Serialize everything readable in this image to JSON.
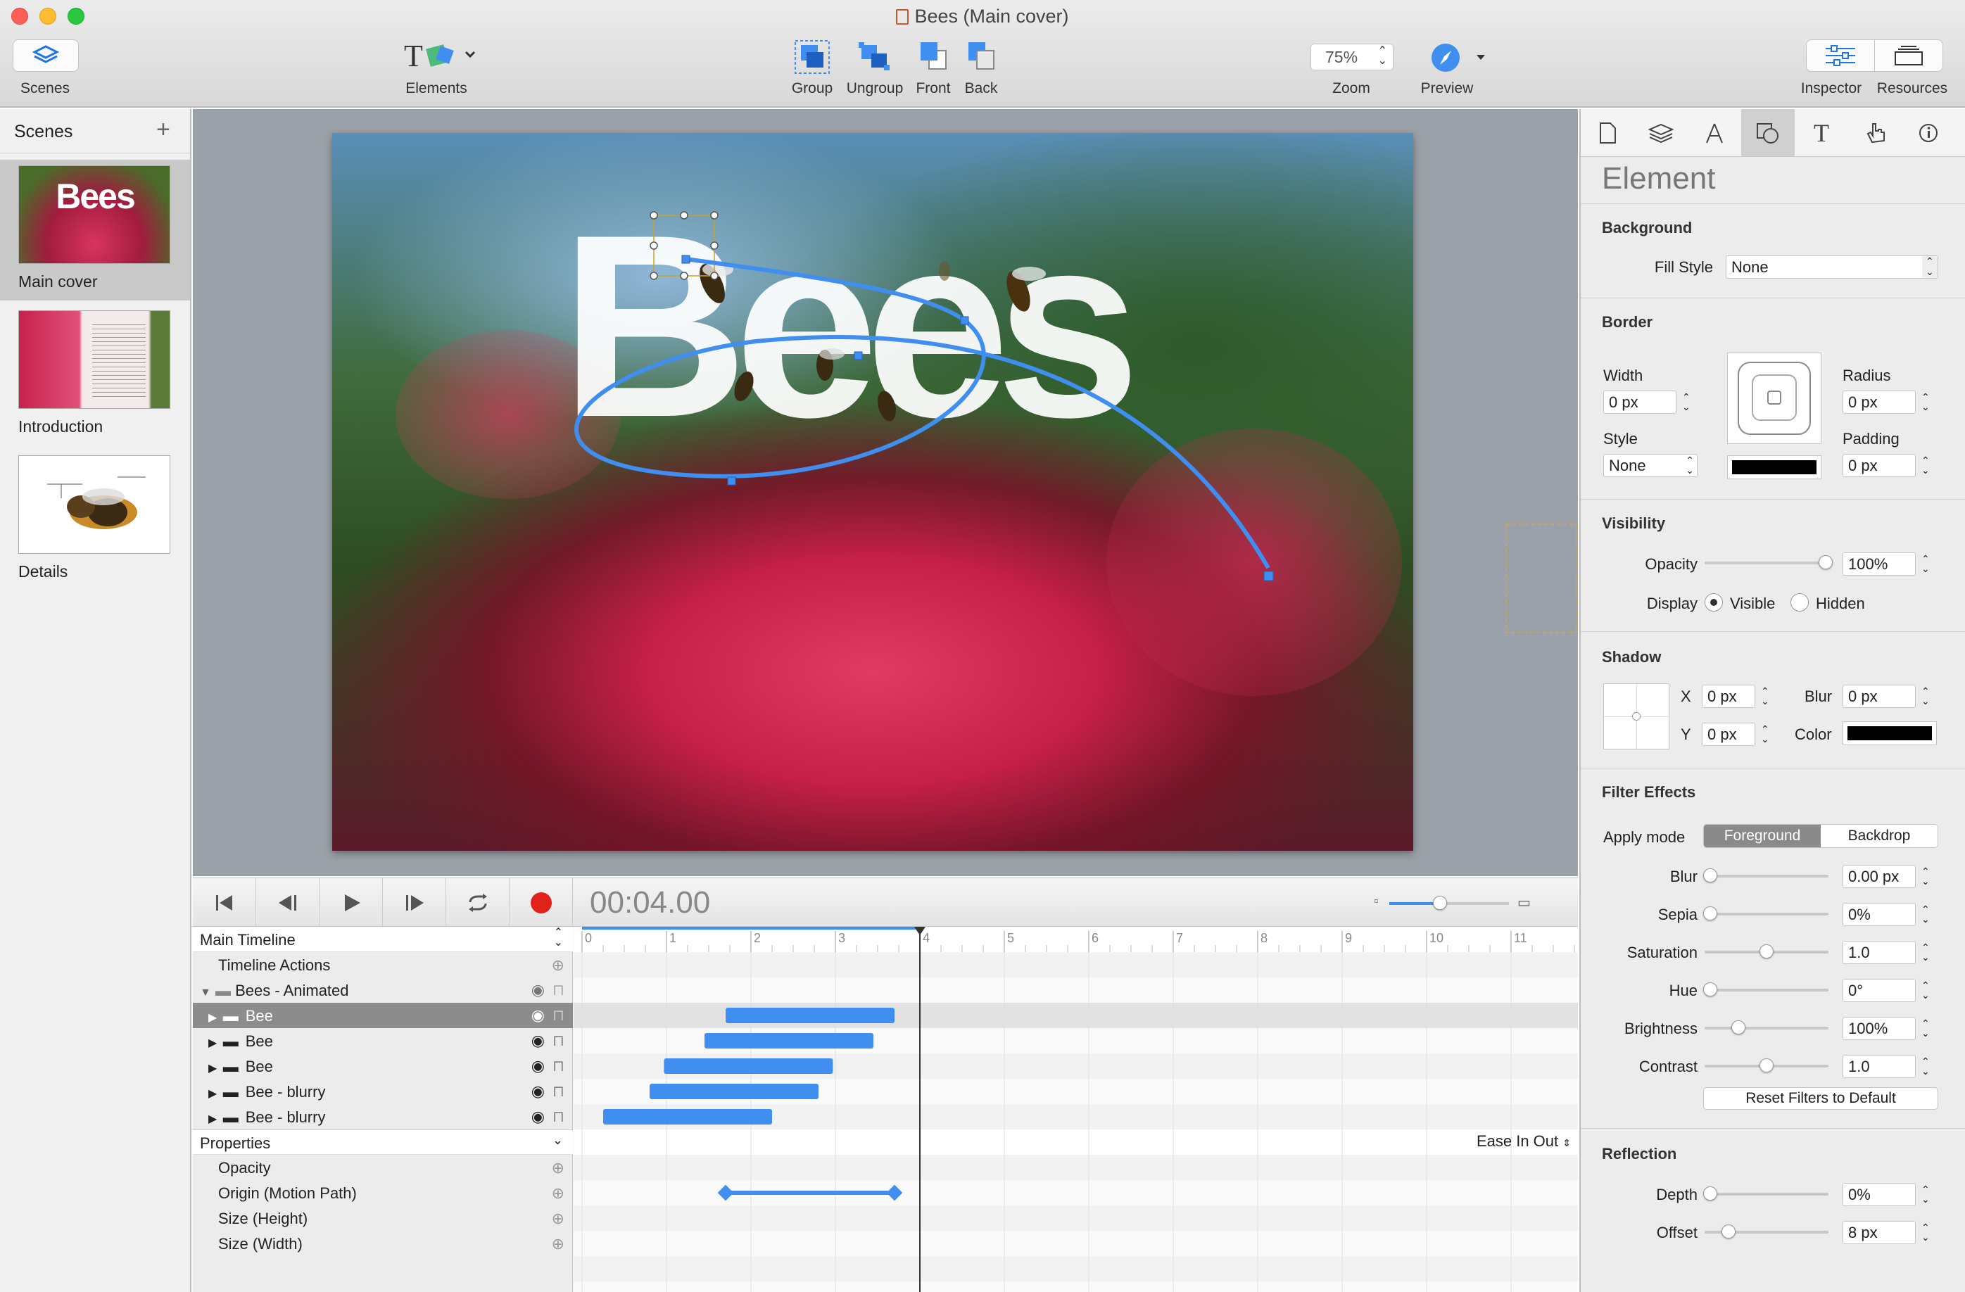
{
  "window": {
    "title": "Bees (Main cover)"
  },
  "toolbar": {
    "scenes": "Scenes",
    "elements": "Elements",
    "group": "Group",
    "ungroup": "Ungroup",
    "front": "Front",
    "back": "Back",
    "zoom_value": "75%",
    "zoom": "Zoom",
    "preview": "Preview",
    "inspector": "Inspector",
    "resources": "Resources"
  },
  "scenes_panel": {
    "header": "Scenes",
    "items": [
      {
        "label": "Main cover",
        "thumb_title": "Bees"
      },
      {
        "label": "Introduction"
      },
      {
        "label": "Details"
      }
    ]
  },
  "canvas": {
    "headline": "Bees"
  },
  "inspector": {
    "title": "Element",
    "background": {
      "title": "Background",
      "fill_style_label": "Fill Style",
      "fill_style_value": "None"
    },
    "border": {
      "title": "Border",
      "width_label": "Width",
      "width_value": "0 px",
      "radius_label": "Radius",
      "radius_value": "0 px",
      "style_label": "Style",
      "style_value": "None",
      "padding_label": "Padding",
      "padding_value": "0 px"
    },
    "visibility": {
      "title": "Visibility",
      "opacity_label": "Opacity",
      "opacity_value": "100%",
      "display_label": "Display",
      "visible": "Visible",
      "hidden": "Hidden"
    },
    "shadow": {
      "title": "Shadow",
      "x_label": "X",
      "x_value": "0 px",
      "y_label": "Y",
      "y_value": "0 px",
      "blur_label": "Blur",
      "blur_value": "0 px",
      "color_label": "Color"
    },
    "filters": {
      "title": "Filter Effects",
      "apply_mode_label": "Apply mode",
      "foreground": "Foreground",
      "backdrop": "Backdrop",
      "rows": [
        {
          "label": "Blur",
          "value": "0.00 px",
          "level": 0
        },
        {
          "label": "Sepia",
          "value": "0%",
          "level": 0
        },
        {
          "label": "Saturation",
          "value": "1.0",
          "level": 0.5
        },
        {
          "label": "Hue",
          "value": "0°",
          "level": 0
        },
        {
          "label": "Brightness",
          "value": "100%",
          "level": 0.25
        },
        {
          "label": "Contrast",
          "value": "1.0",
          "level": 0.5
        }
      ],
      "reset": "Reset Filters to Default"
    },
    "reflection": {
      "title": "Reflection",
      "depth_label": "Depth",
      "depth_value": "0%",
      "offset_label": "Offset",
      "offset_value": "8 px"
    }
  },
  "timeline": {
    "time": "00:04.00",
    "main": "Main Timeline",
    "actions": "Timeline Actions",
    "group": "Bees - Animated",
    "layers": [
      {
        "name": "Bee",
        "start": 1.7,
        "end": 3.7
      },
      {
        "name": "Bee",
        "start": 1.45,
        "end": 3.45
      },
      {
        "name": "Bee",
        "start": 0.97,
        "end": 2.97
      },
      {
        "name": "Bee - blurry",
        "start": 0.8,
        "end": 2.8
      },
      {
        "name": "Bee - blurry",
        "start": 0.25,
        "end": 2.25
      }
    ],
    "properties": "Properties",
    "easing": "Ease In Out",
    "props": [
      {
        "name": "Opacity"
      },
      {
        "name": "Origin (Motion Path)",
        "start": 1.7,
        "end": 3.7
      },
      {
        "name": "Size (Height)"
      },
      {
        "name": "Size (Width)"
      }
    ],
    "ruler": [
      "0",
      "1",
      "2",
      "3",
      "4",
      "5",
      "6",
      "7",
      "8",
      "9",
      "10",
      "11"
    ],
    "playhead": 4
  },
  "colors": {
    "accent": "#3f8ef0",
    "record": "#e0221b"
  }
}
